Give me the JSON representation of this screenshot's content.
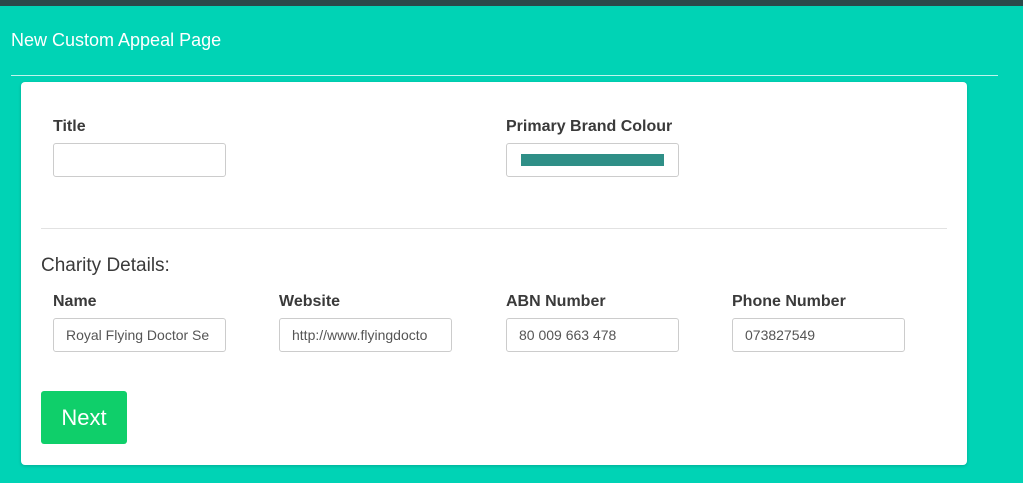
{
  "header": {
    "title": "New Custom Appeal Page"
  },
  "form": {
    "title_label": "Title",
    "title_value": "",
    "brand_colour_label": "Primary Brand Colour",
    "brand_colour_value": "#2f8f87"
  },
  "charity": {
    "section_title": "Charity Details:",
    "name_label": "Name",
    "name_value": "Royal Flying Doctor Se",
    "website_label": "Website",
    "website_value": "http://www.flyingdocto",
    "abn_label": "ABN Number",
    "abn_value": "80 009 663 478",
    "phone_label": "Phone Number",
    "phone_value": "073827549"
  },
  "actions": {
    "next_label": "Next"
  },
  "colors": {
    "page_background": "#00d3b5",
    "top_bar": "#2b4a4a",
    "next_button": "#0fcf6a"
  }
}
